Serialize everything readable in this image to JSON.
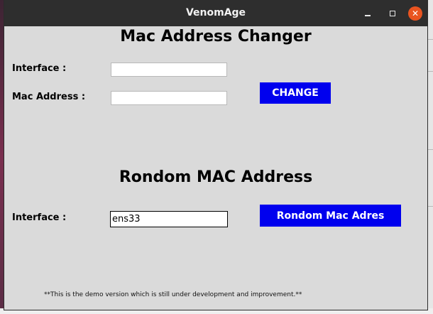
{
  "window": {
    "title": "VenomAge",
    "controls": {
      "minimize_icon": "minimize-icon",
      "maximize_icon": "maximize-icon",
      "close_icon": "close-icon",
      "close_color": "#e95420"
    }
  },
  "mac_changer": {
    "heading": "Mac Address Changer",
    "interface_label": "Interface :",
    "interface_value": "",
    "mac_label": "Mac Address :",
    "mac_value": "",
    "change_button": "CHANGE"
  },
  "random_mac": {
    "heading": "Rondom MAC Address",
    "interface_label": "Interface :",
    "interface_value": "ens33",
    "random_button": "Rondom Mac Adres"
  },
  "footer": {
    "note": "**This is the demo version which is still under development and improvement.**"
  },
  "colors": {
    "button_bg": "#0000ee",
    "button_text": "#ffffff",
    "window_bg": "#dadada",
    "titlebar_bg": "#2e2e2e"
  }
}
